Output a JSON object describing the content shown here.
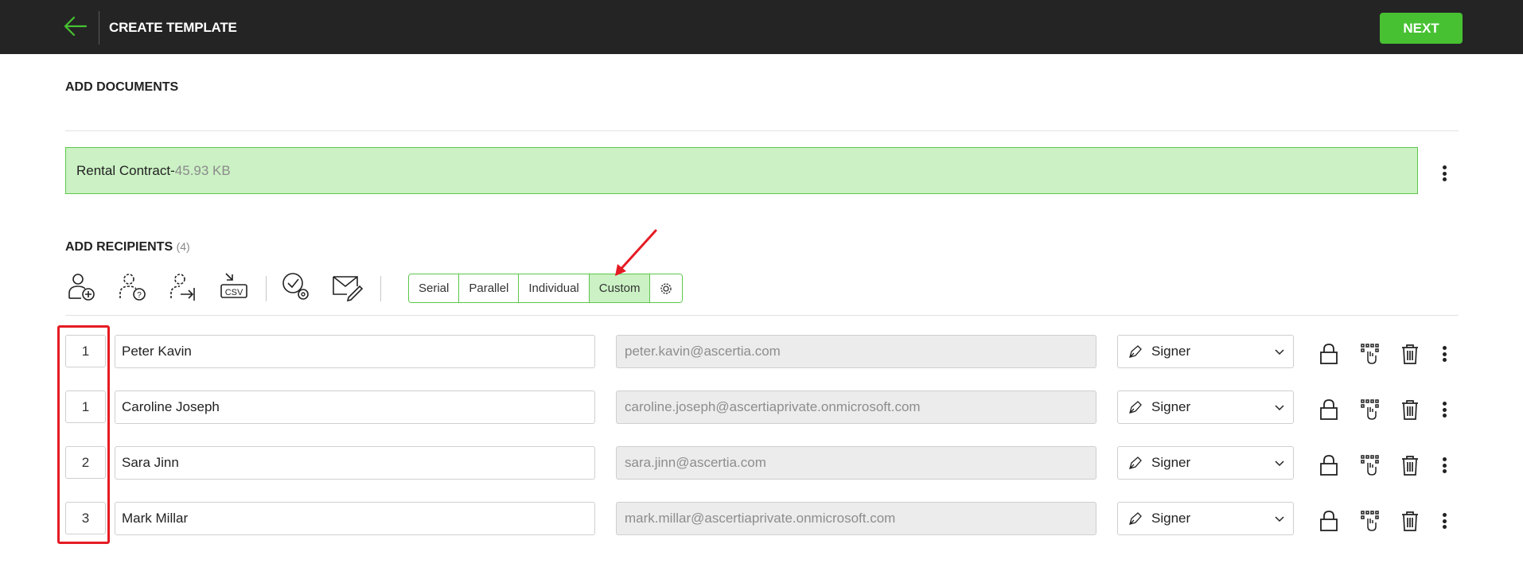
{
  "header": {
    "title": "CREATE TEMPLATE",
    "next_label": "NEXT"
  },
  "documents": {
    "section_title": "ADD DOCUMENTS",
    "items": [
      {
        "name": "Rental Contract- ",
        "size": "45.93 KB"
      }
    ]
  },
  "recipients": {
    "section_title": "ADD RECIPIENTS",
    "count": "(4)",
    "toolbar_icons": [
      "add-recipient-icon",
      "add-unknown-recipient-icon",
      "import-recipient-icon",
      "csv-import-icon",
      "approval-settings-icon",
      "email-message-icon"
    ],
    "modes": [
      "Serial",
      "Parallel",
      "Individual",
      "Custom"
    ],
    "active_mode": "Custom",
    "rows": [
      {
        "order": "1",
        "name": "Peter Kavin",
        "email": "peter.kavin@ascertia.com",
        "role": "Signer"
      },
      {
        "order": "1",
        "name": "Caroline Joseph",
        "email": "caroline.joseph@ascertiaprivate.onmicrosoft.com",
        "role": "Signer"
      },
      {
        "order": "2",
        "name": "Sara Jinn",
        "email": "sara.jinn@ascertia.com",
        "role": "Signer"
      },
      {
        "order": "3",
        "name": "Mark Millar",
        "email": "mark.millar@ascertiaprivate.onmicrosoft.com",
        "role": "Signer"
      }
    ]
  },
  "colors": {
    "topbar": "#242424",
    "accent": "#47c132",
    "doc_fill": "#cbf1c4",
    "annotation": "#e51b24"
  }
}
